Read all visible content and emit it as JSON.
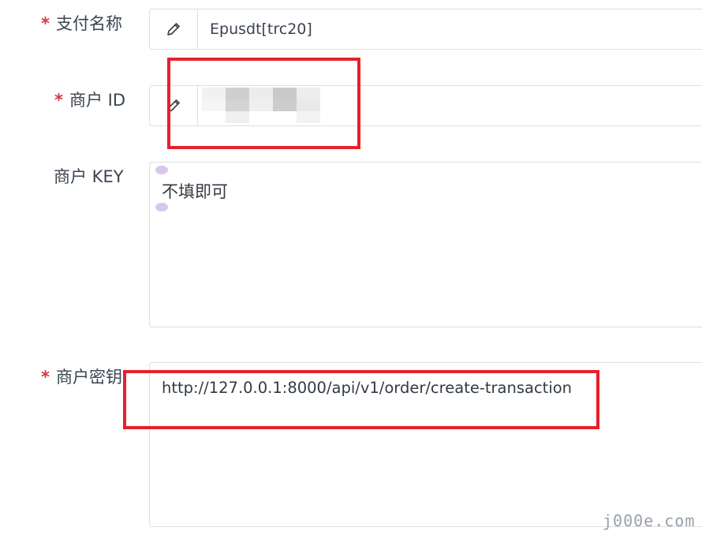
{
  "form": {
    "pay_name": {
      "label": "支付名称",
      "required_mark": "*",
      "value": "Epusdt[trc20]",
      "icon": "pencil-icon"
    },
    "merchant_id": {
      "label": "商户 ID",
      "required_mark": "*",
      "icon": "pencil-icon"
    },
    "merchant_key": {
      "label": "商户 KEY",
      "value": "不填即可"
    },
    "merchant_secret": {
      "label": "商户密钥",
      "required_mark": "*",
      "value": "http://127.0.0.1:8000/api/v1/order/create-transaction"
    }
  },
  "colors": {
    "highlight_border": "#e8202a",
    "required": "#d9363e",
    "input_border": "#dcdfe6"
  },
  "watermark": "j000e.com"
}
